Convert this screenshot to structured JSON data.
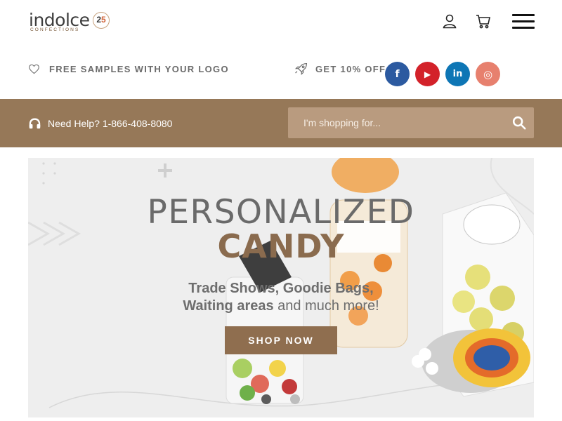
{
  "brand": {
    "name": "indolce",
    "sub": "CONFECTIONS",
    "badge_a": "2",
    "badge_b": "5"
  },
  "promo": {
    "free_samples": "FREE SAMPLES WITH YOUR LOGO",
    "discount": "GET 10% OFF"
  },
  "social": {
    "facebook": "f",
    "youtube": "▶",
    "linkedin": "in",
    "instagram": "◎"
  },
  "help": {
    "text": "Need Help? 1-866-408-8080"
  },
  "search": {
    "placeholder": "I'm shopping for..."
  },
  "hero": {
    "title": "PERSONALIZED",
    "subtitle": "CANDY",
    "line1": "Trade Shows, Goodie Bags,",
    "line2_bold": "Waiting areas",
    "line2_rest": " and much more!",
    "cta": "SHOP NOW"
  },
  "colors": {
    "accent_brown": "#967858",
    "button_brown": "#8f6e4f",
    "search_bg": "#b99b7f"
  },
  "icons": [
    "user-icon",
    "cart-icon",
    "menu-icon",
    "heart-icon",
    "rocket-icon",
    "headphones-icon",
    "search-icon"
  ]
}
